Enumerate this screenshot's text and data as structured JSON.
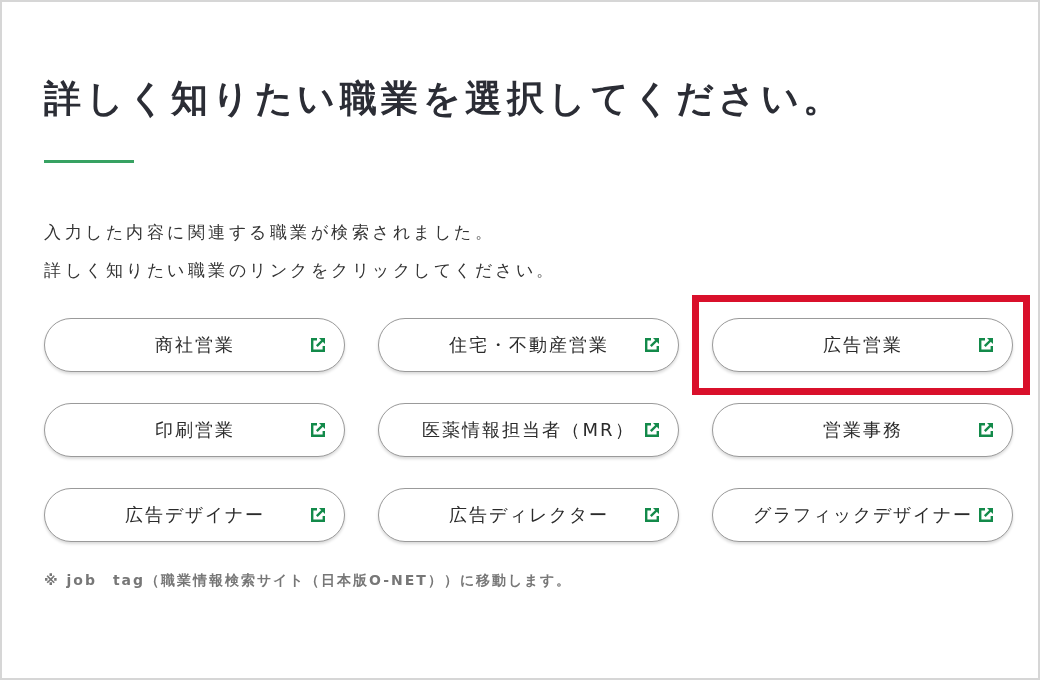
{
  "heading": "詳しく知りたい職業を選択してください。",
  "intro": [
    "入力した内容に関連する職業が検索されました。",
    "詳しく知りたい職業のリンクをクリックしてください。"
  ],
  "jobs": [
    {
      "label": "商社営業",
      "highlighted": false
    },
    {
      "label": "住宅・不動産営業",
      "highlighted": false
    },
    {
      "label": "広告営業",
      "highlighted": true
    },
    {
      "label": "印刷営業",
      "highlighted": false
    },
    {
      "label": "医薬情報担当者（MR）",
      "highlighted": false
    },
    {
      "label": "営業事務",
      "highlighted": false
    },
    {
      "label": "広告デザイナー",
      "highlighted": false
    },
    {
      "label": "広告ディレクター",
      "highlighted": false
    },
    {
      "label": "グラフィックデザイナー",
      "highlighted": false
    }
  ],
  "note": "※ job　tag（職業情報検索サイト（日本版O-NET））に移動します。"
}
